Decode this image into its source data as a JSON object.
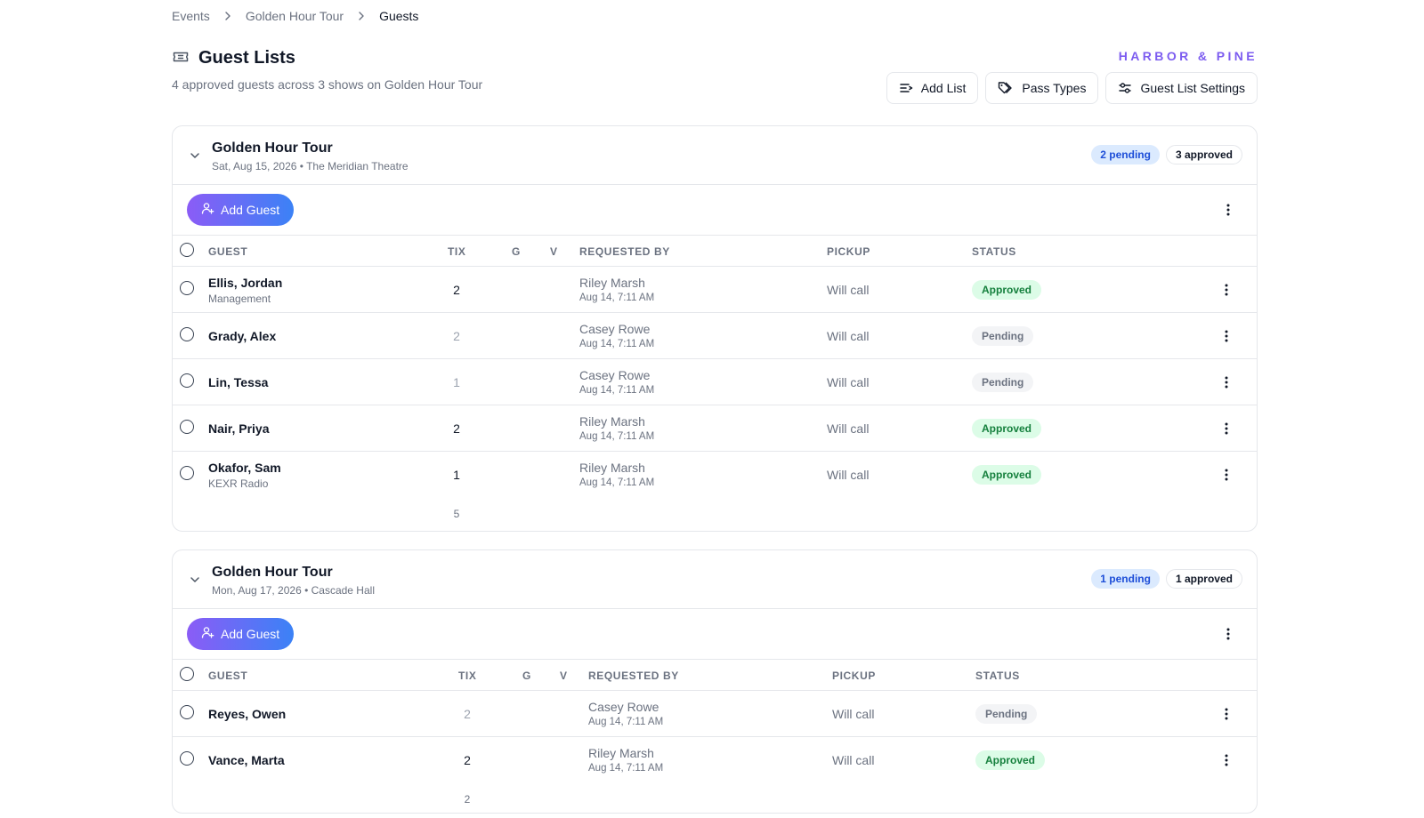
{
  "breadcrumb": [
    "Events",
    "Golden Hour Tour",
    "Guests"
  ],
  "page": {
    "title": "Guest Lists",
    "subtitle": "4 approved guests across 3 shows on Golden Hour Tour",
    "brand": "HARBOR & PINE"
  },
  "actions": {
    "add_list": "Add List",
    "pass_types": "Pass Types",
    "settings": "Guest List Settings"
  },
  "columns": {
    "guest": "GUEST",
    "tix": "TIX",
    "g": "G",
    "v": "V",
    "requested_by": "REQUESTED BY",
    "pickup": "PICKUP",
    "status": "STATUS"
  },
  "add_guest_label": "Add Guest",
  "colors": {
    "brand": "#7c5cf0",
    "gradient_start": "#8b5cf6",
    "gradient_end": "#3b82f6",
    "approved": "#15803d",
    "pending_badge": "#1d4ed8"
  },
  "shows": [
    {
      "name": "Golden Hour Tour",
      "meta": "Sat, Aug 15, 2026 • The Meridian Theatre",
      "pending_badge": "2 pending",
      "approved_badge": "3 approved",
      "total_tix": "5",
      "guests": [
        {
          "name": "Ellis, Jordan",
          "sub": "Management",
          "tix": "2",
          "requested_by": "Riley Marsh",
          "requested_at": "Aug 14, 7:11 AM",
          "pickup": "Will call",
          "status": "Approved"
        },
        {
          "name": "Grady, Alex",
          "sub": "",
          "tix": "2",
          "requested_by": "Casey Rowe",
          "requested_at": "Aug 14, 7:11 AM",
          "pickup": "Will call",
          "status": "Pending"
        },
        {
          "name": "Lin, Tessa",
          "sub": "",
          "tix": "1",
          "requested_by": "Casey Rowe",
          "requested_at": "Aug 14, 7:11 AM",
          "pickup": "Will call",
          "status": "Pending"
        },
        {
          "name": "Nair, Priya",
          "sub": "",
          "tix": "2",
          "requested_by": "Riley Marsh",
          "requested_at": "Aug 14, 7:11 AM",
          "pickup": "Will call",
          "status": "Approved"
        },
        {
          "name": "Okafor, Sam",
          "sub": "KEXR Radio",
          "tix": "1",
          "requested_by": "Riley Marsh",
          "requested_at": "Aug 14, 7:11 AM",
          "pickup": "Will call",
          "status": "Approved"
        }
      ]
    },
    {
      "name": "Golden Hour Tour",
      "meta": "Mon, Aug 17, 2026 • Cascade Hall",
      "pending_badge": "1 pending",
      "approved_badge": "1 approved",
      "total_tix": "2",
      "guests": [
        {
          "name": "Reyes, Owen",
          "sub": "",
          "tix": "2",
          "requested_by": "Casey Rowe",
          "requested_at": "Aug 14, 7:11 AM",
          "pickup": "Will call",
          "status": "Pending"
        },
        {
          "name": "Vance, Marta",
          "sub": "",
          "tix": "2",
          "requested_by": "Riley Marsh",
          "requested_at": "Aug 14, 7:11 AM",
          "pickup": "Will call",
          "status": "Approved"
        }
      ]
    }
  ]
}
